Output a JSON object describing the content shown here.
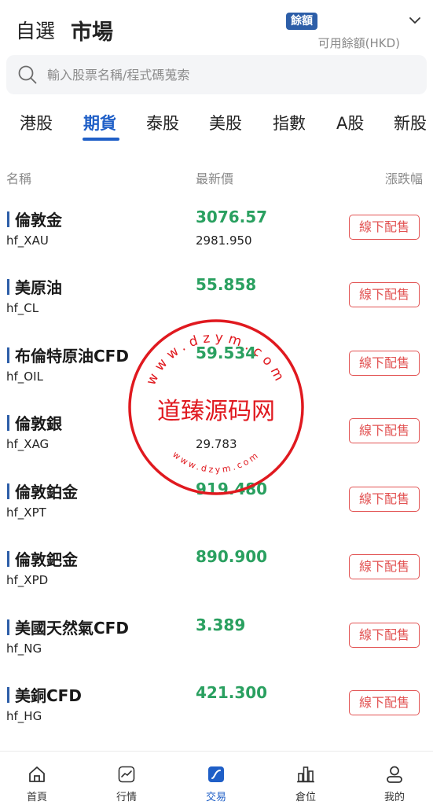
{
  "header": {
    "tab_watchlist": "自選",
    "tab_market": "市場",
    "badge": "餘額",
    "available_label": "可用餘額(HKD)"
  },
  "search": {
    "placeholder": "輸入股票名稱/程式碼蒐索"
  },
  "market_tabs": [
    "港股",
    "期貨",
    "泰股",
    "美股",
    "指數",
    "A股",
    "新股"
  ],
  "active_tab": "期貨",
  "columns": {
    "name": "名稱",
    "price": "最新價",
    "change": "漲跌幅"
  },
  "rows": [
    {
      "name": "倫敦金",
      "code": "hf_XAU",
      "price": "3076.57",
      "sub": "2981.950",
      "action": "線下配售"
    },
    {
      "name": "美原油",
      "code": "hf_CL",
      "price": "55.858",
      "sub": "",
      "action": "線下配售"
    },
    {
      "name": "布倫特原油CFD",
      "code": "hf_OIL",
      "price": "59.534",
      "sub": "",
      "action": "線下配售"
    },
    {
      "name": "倫敦銀",
      "code": "hf_XAG",
      "price": "",
      "sub": "29.783",
      "action": "線下配售"
    },
    {
      "name": "倫敦鉑金",
      "code": "hf_XPT",
      "price": "919.480",
      "sub": "",
      "action": "線下配售"
    },
    {
      "name": "倫敦鈀金",
      "code": "hf_XPD",
      "price": "890.900",
      "sub": "",
      "action": "線下配售"
    },
    {
      "name": "美國天然氣CFD",
      "code": "hf_NG",
      "price": "3.389",
      "sub": "",
      "action": "線下配售"
    },
    {
      "name": "美銅CFD",
      "code": "hf_HG",
      "price": "421.300",
      "sub": "",
      "action": "線下配售"
    }
  ],
  "bottom_nav": [
    {
      "label": "首頁",
      "icon": "home-icon"
    },
    {
      "label": "行情",
      "icon": "chart-icon"
    },
    {
      "label": "交易",
      "icon": "trade-icon"
    },
    {
      "label": "倉位",
      "icon": "position-icon"
    },
    {
      "label": "我的",
      "icon": "profile-icon"
    }
  ],
  "active_nav": "交易",
  "watermark": {
    "text": "道臻源码网",
    "url_top": "www.dzym.com",
    "url_bottom": "www.dzym.com"
  },
  "colors": {
    "accent": "#1f5fc7",
    "up_green": "#2aa060",
    "action_red": "#e25353",
    "stamp_red": "#e0191f"
  }
}
